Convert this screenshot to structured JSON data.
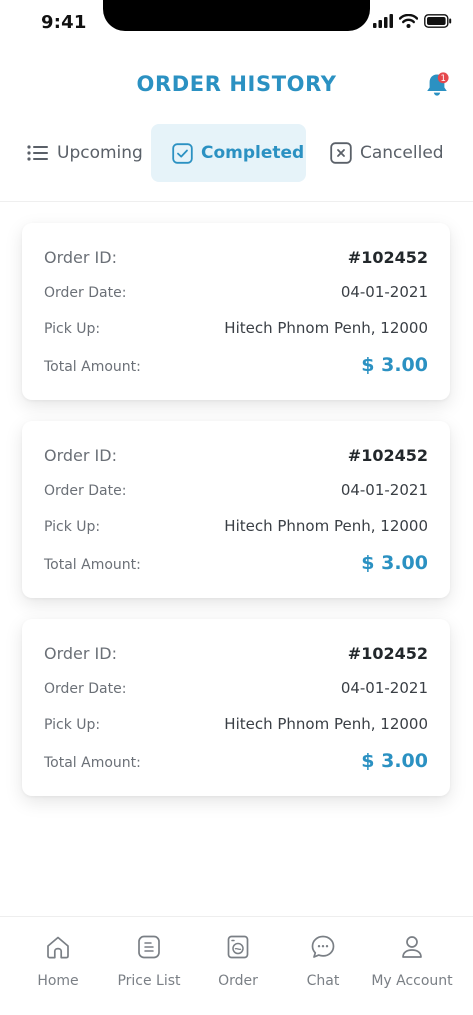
{
  "status": {
    "time": "9:41"
  },
  "header": {
    "title": "ORDER HISTORY",
    "notification_count": "1"
  },
  "tabs": [
    {
      "label": "Upcoming",
      "icon": "list-icon"
    },
    {
      "label": "Completed",
      "icon": "check-square-icon",
      "active": true
    },
    {
      "label": "Cancelled",
      "icon": "x-square-icon"
    }
  ],
  "labels": {
    "order_id": "Order ID:",
    "order_date": "Order Date:",
    "pick_up": "Pick Up:",
    "total_amount": "Total Amount:"
  },
  "orders": [
    {
      "id": "#102452",
      "date": "04-01-2021",
      "pickup": "Hitech Phnom Penh, 12000",
      "amount": "$ 3.00"
    },
    {
      "id": "#102452",
      "date": "04-01-2021",
      "pickup": "Hitech Phnom Penh, 12000",
      "amount": "$ 3.00"
    },
    {
      "id": "#102452",
      "date": "04-01-2021",
      "pickup": "Hitech Phnom Penh, 12000",
      "amount": "$ 3.00"
    }
  ],
  "nav": [
    {
      "label": "Home",
      "icon": "home-icon"
    },
    {
      "label": "Price List",
      "icon": "price-list-icon"
    },
    {
      "label": "Order",
      "icon": "order-icon"
    },
    {
      "label": "Chat",
      "icon": "chat-icon"
    },
    {
      "label": "My Account",
      "icon": "user-icon"
    }
  ],
  "colors": {
    "accent": "#2b91c2",
    "active_tab_bg": "#e6f3f9",
    "badge": "#e5484d"
  }
}
